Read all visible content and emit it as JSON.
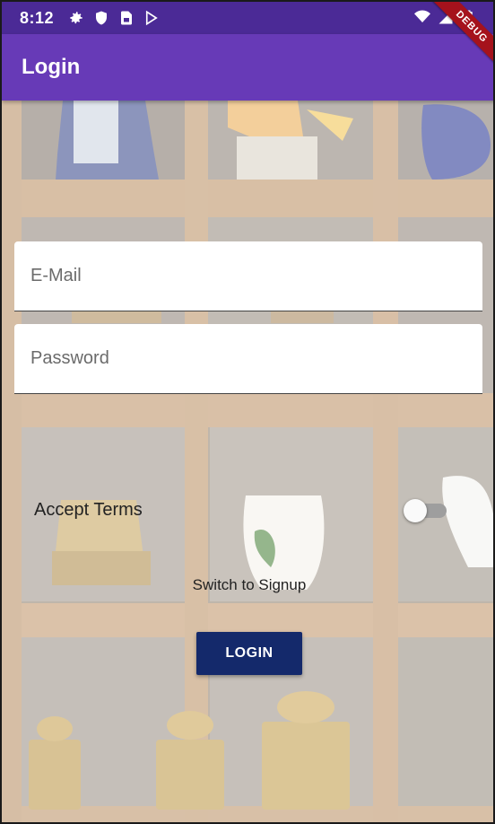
{
  "status_bar": {
    "time": "8:12",
    "left_icons": [
      "settings-icon",
      "shield-icon",
      "sim-card-icon",
      "play-store-icon"
    ],
    "right_icons": [
      "wifi-icon",
      "cell-signal-icon",
      "battery-icon"
    ]
  },
  "app_bar": {
    "title": "Login",
    "color": "#673ab7"
  },
  "debug_banner": "DEBUG",
  "form": {
    "email": {
      "value": "",
      "placeholder": "E-Mail"
    },
    "password": {
      "value": "",
      "placeholder": "Password"
    },
    "accept_terms": {
      "label": "Accept Terms",
      "checked": false
    },
    "switch_mode_label": "Switch to Signup",
    "submit_label": "LOGIN",
    "submit_color": "#14296b"
  }
}
